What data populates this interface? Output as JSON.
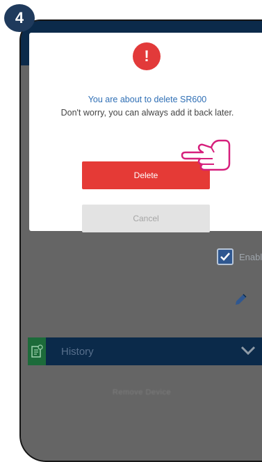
{
  "step_badge": "4",
  "dialog": {
    "alert_icon": "!",
    "title": "You are about to delete SR600",
    "message": "Don't worry, you can always add it back later.",
    "delete_label": "Delete",
    "cancel_label": "Cancel"
  },
  "background": {
    "enable_label": "Enable",
    "enable_checked": true,
    "history_label": "History",
    "blurred_text": "Remove Device"
  },
  "colors": {
    "accent_red": "#e53a36",
    "navy": "#0b2a4a",
    "link_blue": "#2f6fb5",
    "overlay_gray": "#656565"
  },
  "icons": {
    "alert": "alert-icon",
    "checkbox": "checkbox-checked-icon",
    "edit": "pencil-icon",
    "history": "history-icon",
    "chevron": "chevron-down-icon",
    "pointer": "pointing-hand-icon"
  }
}
